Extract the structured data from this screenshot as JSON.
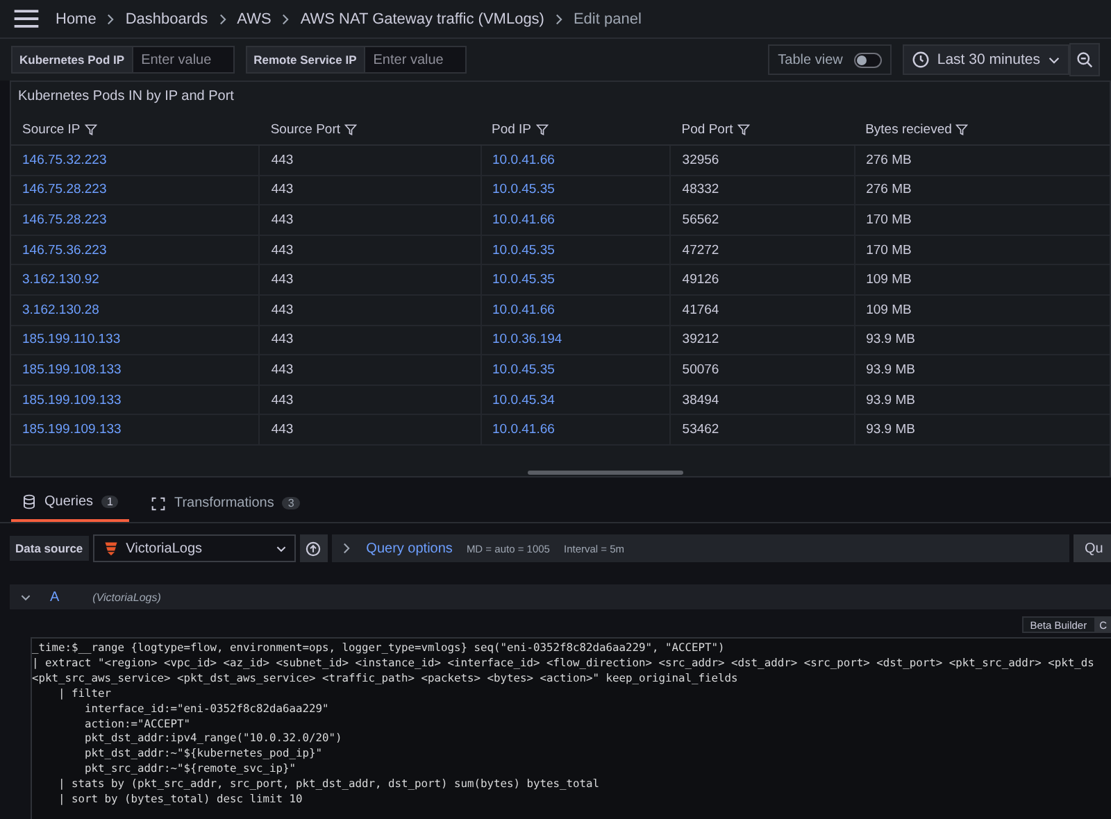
{
  "breadcrumbs": [
    "Home",
    "Dashboards",
    "AWS",
    "AWS NAT Gateway traffic (VMLogs)",
    "Edit panel"
  ],
  "variables": [
    {
      "label": "Kubernetes Pod IP",
      "placeholder": "Enter value"
    },
    {
      "label": "Remote Service IP",
      "placeholder": "Enter value"
    }
  ],
  "table_view": {
    "label": "Table view",
    "on": false
  },
  "time_range": "Last 30 minutes",
  "panel": {
    "title": "Kubernetes Pods IN by IP and Port",
    "columns": [
      "Source IP",
      "Source Port",
      "Pod IP",
      "Pod Port",
      "Bytes recieved"
    ],
    "rows": [
      [
        "146.75.32.223",
        "443",
        "10.0.41.66",
        "32956",
        "276 MB"
      ],
      [
        "146.75.28.223",
        "443",
        "10.0.45.35",
        "48332",
        "276 MB"
      ],
      [
        "146.75.28.223",
        "443",
        "10.0.41.66",
        "56562",
        "170 MB"
      ],
      [
        "146.75.36.223",
        "443",
        "10.0.45.35",
        "47272",
        "170 MB"
      ],
      [
        "3.162.130.92",
        "443",
        "10.0.45.35",
        "49126",
        "109 MB"
      ],
      [
        "3.162.130.28",
        "443",
        "10.0.41.66",
        "41764",
        "109 MB"
      ],
      [
        "185.199.110.133",
        "443",
        "10.0.36.194",
        "39212",
        "93.9 MB"
      ],
      [
        "185.199.108.133",
        "443",
        "10.0.45.35",
        "50076",
        "93.9 MB"
      ],
      [
        "185.199.109.133",
        "443",
        "10.0.45.34",
        "38494",
        "93.9 MB"
      ],
      [
        "185.199.109.133",
        "443",
        "10.0.41.66",
        "53462",
        "93.9 MB"
      ]
    ]
  },
  "tabs": [
    {
      "label": "Queries",
      "count": "1",
      "selected": true
    },
    {
      "label": "Transformations",
      "count": "3",
      "selected": false
    }
  ],
  "data_source": {
    "label": "Data source",
    "value": "VictoriaLogs"
  },
  "query_options": {
    "label": "Query options",
    "md": "MD = auto = 1005",
    "interval": "Interval = 5m"
  },
  "query_button": "Qu",
  "query": {
    "ref": "A",
    "source": "(VictoriaLogs)",
    "expanded": true
  },
  "editor_modes": [
    "Beta Builder",
    "C"
  ],
  "code_lines": [
    "_time:$__range {logtype=flow, environment=ops, logger_type=vmlogs} seq(\"eni-0352f8c82da6aa229\", \"ACCEPT\")",
    "| extract \"<region> <vpc_id> <az_id> <subnet_id> <instance_id> <interface_id> <flow_direction> <src_addr> <dst_addr> <src_port> <dst_port> <pkt_src_addr> <pkt_ds",
    "<pkt_src_aws_service> <pkt_dst_aws_service> <traffic_path> <packets> <bytes> <action>\" keep_original_fields",
    "    | filter",
    "        interface_id:=\"eni-0352f8c82da6aa229\"",
    "        action:=\"ACCEPT\"",
    "        pkt_dst_addr:ipv4_range(\"10.0.32.0/20\")",
    "        pkt_dst_addr:~\"${kubernetes_pod_ip}\"",
    "        pkt_src_addr:~\"${remote_svc_ip}\"",
    "    | stats by (pkt_src_addr, src_port, pkt_dst_addr, dst_port) sum(bytes) bytes_total",
    "    | sort by (bytes_total) desc limit 10"
  ]
}
